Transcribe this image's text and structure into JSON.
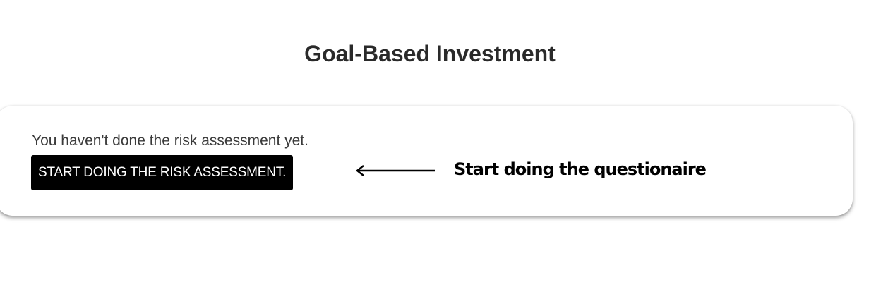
{
  "page": {
    "title": "Goal-Based Investment"
  },
  "card": {
    "status_text": "You haven't done the risk assessment yet.",
    "start_button_label": "START DOING THE RISK ASSESSMENT."
  },
  "annotation": {
    "arrow_icon": "left-arrow-icon",
    "text": "Start doing the questionaire"
  },
  "colors": {
    "button_background": "#000000",
    "button_text": "#ffffff",
    "title_text": "#2a2a2a",
    "body_text": "#3a3a3a"
  }
}
